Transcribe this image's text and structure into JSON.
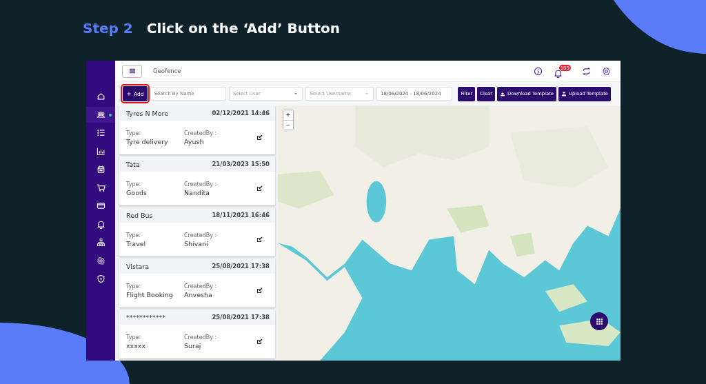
{
  "slide": {
    "step": "Step 2",
    "heading": "Click on the ‘Add’ Button"
  },
  "top_bar": {
    "title": "Geofence",
    "notification_count": "159"
  },
  "sidebar": {
    "items": [
      {
        "selected": false
      },
      {
        "selected": true
      },
      {
        "selected": false
      },
      {
        "selected": false
      },
      {
        "selected": false
      },
      {
        "selected": false
      },
      {
        "selected": false
      },
      {
        "selected": false
      },
      {
        "selected": false
      },
      {
        "selected": false
      },
      {
        "selected": false
      }
    ]
  },
  "toolbar": {
    "add_button": {
      "label": "Add",
      "highlighted": true
    },
    "search": {
      "placeholder": "Search By Name"
    },
    "user_select": {
      "placeholder": "Select User"
    },
    "username_select": {
      "placeholder": "Select Username"
    },
    "date_range": {
      "value": "18/06/2024 - 18/06/2024"
    },
    "buttons": [
      {
        "label": "Filter",
        "kind": "plain"
      },
      {
        "label": "Clear",
        "kind": "plain"
      },
      {
        "label": "Download Template",
        "kind": "download"
      },
      {
        "label": "Upload Template",
        "kind": "upload"
      }
    ]
  },
  "geofences": [
    {
      "name": "Tyres N More",
      "date": "02/12/2021 14:46",
      "type_label": "Type:",
      "type": "Tyre delivery",
      "created_label": "CreatedBy :",
      "created_by": "Ayush"
    },
    {
      "name": "Tata",
      "date": "21/03/2023 15:50",
      "type_label": "Type:",
      "type": "Goods",
      "created_label": "CreatedBy :",
      "created_by": "Nandita"
    },
    {
      "name": "Red Bus",
      "date": "18/11/2021 16:46",
      "type_label": "Type:",
      "type": "Travel",
      "created_label": "CreatedBy :",
      "created_by": "Shivani"
    },
    {
      "name": "Vistara",
      "date": "25/08/2021 17:38",
      "type_label": "Type:",
      "type": "Flight Booking",
      "created_label": "CreatedBy :",
      "created_by": "Anvesha"
    },
    {
      "name": "************",
      "date": "25/08/2021 17:38",
      "type_label": "Type:",
      "type": "xxxxx",
      "created_label": "CreatedBy :",
      "created_by": "Suraj"
    }
  ],
  "map": {
    "kind": "picture",
    "zoom_in": "+",
    "zoom_out": "−"
  }
}
